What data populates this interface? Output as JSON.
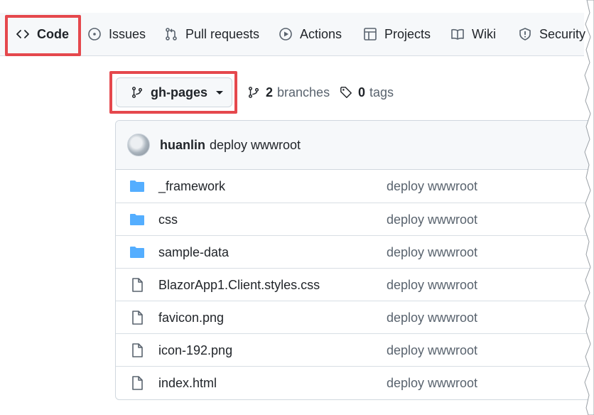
{
  "tabs": [
    {
      "label": "Code",
      "icon": "code-icon",
      "selected": true
    },
    {
      "label": "Issues",
      "icon": "issue-opened-icon"
    },
    {
      "label": "Pull requests",
      "icon": "git-pull-request-icon"
    },
    {
      "label": "Actions",
      "icon": "play-icon"
    },
    {
      "label": "Projects",
      "icon": "table-icon"
    },
    {
      "label": "Wiki",
      "icon": "book-icon"
    },
    {
      "label": "Security",
      "icon": "shield-icon"
    }
  ],
  "branch": {
    "current": "gh-pages",
    "branches_count": "2",
    "branches_label": "branches",
    "tags_count": "0",
    "tags_label": "tags"
  },
  "commit": {
    "author": "huanlin",
    "message": "deploy wwwroot"
  },
  "files": [
    {
      "name": "_framework",
      "type": "folder",
      "message": "deploy wwwroot"
    },
    {
      "name": "css",
      "type": "folder",
      "message": "deploy wwwroot"
    },
    {
      "name": "sample-data",
      "type": "folder",
      "message": "deploy wwwroot"
    },
    {
      "name": "BlazorApp1.Client.styles.css",
      "type": "file",
      "message": "deploy wwwroot"
    },
    {
      "name": "favicon.png",
      "type": "file",
      "message": "deploy wwwroot"
    },
    {
      "name": "icon-192.png",
      "type": "file",
      "message": "deploy wwwroot"
    },
    {
      "name": "index.html",
      "type": "file",
      "message": "deploy wwwroot"
    }
  ],
  "colors": {
    "highlight": "#e5484d",
    "folder": "#54aeff",
    "muted": "#59636e"
  }
}
